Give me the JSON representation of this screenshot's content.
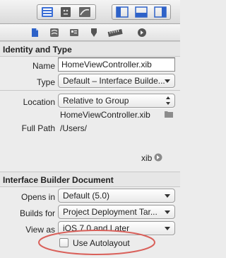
{
  "toolbar": {
    "icons": [
      "navigator-list-icon",
      "utilities-panel-icon",
      "version-editor-icon",
      "left-panel-icon",
      "bottom-panel-icon",
      "right-panel-icon"
    ]
  },
  "inspector_tabs": {
    "icons": [
      "file-inspector-icon",
      "quick-help-icon",
      "identity-inspector-icon",
      "attributes-inspector-icon",
      "size-inspector-icon",
      "connections-inspector-icon"
    ]
  },
  "identity": {
    "header": "Identity and Type",
    "name_label": "Name",
    "name_value": "HomeViewController.xib",
    "type_label": "Type",
    "type_value": "Default – Interface Builde...",
    "location_label": "Location",
    "location_value": "Relative to Group",
    "location_path": "HomeViewController.xib",
    "fullpath_label": "Full Path",
    "fullpath_value": "/Users/",
    "fullpath_tail": "xib"
  },
  "ib_document": {
    "header": "Interface Builder Document",
    "opens_in_label": "Opens in",
    "opens_in_value": "Default (5.0)",
    "builds_for_label": "Builds for",
    "builds_for_value": "Project Deployment Tar...",
    "view_as_label": "View as",
    "view_as_value": "iOS 7.0 and Later",
    "autolayout_label": "Use Autolayout",
    "autolayout_checked": false
  },
  "colors": {
    "highlight_circle": "#d9605a",
    "toolbar_selected": "#2e62c8"
  }
}
